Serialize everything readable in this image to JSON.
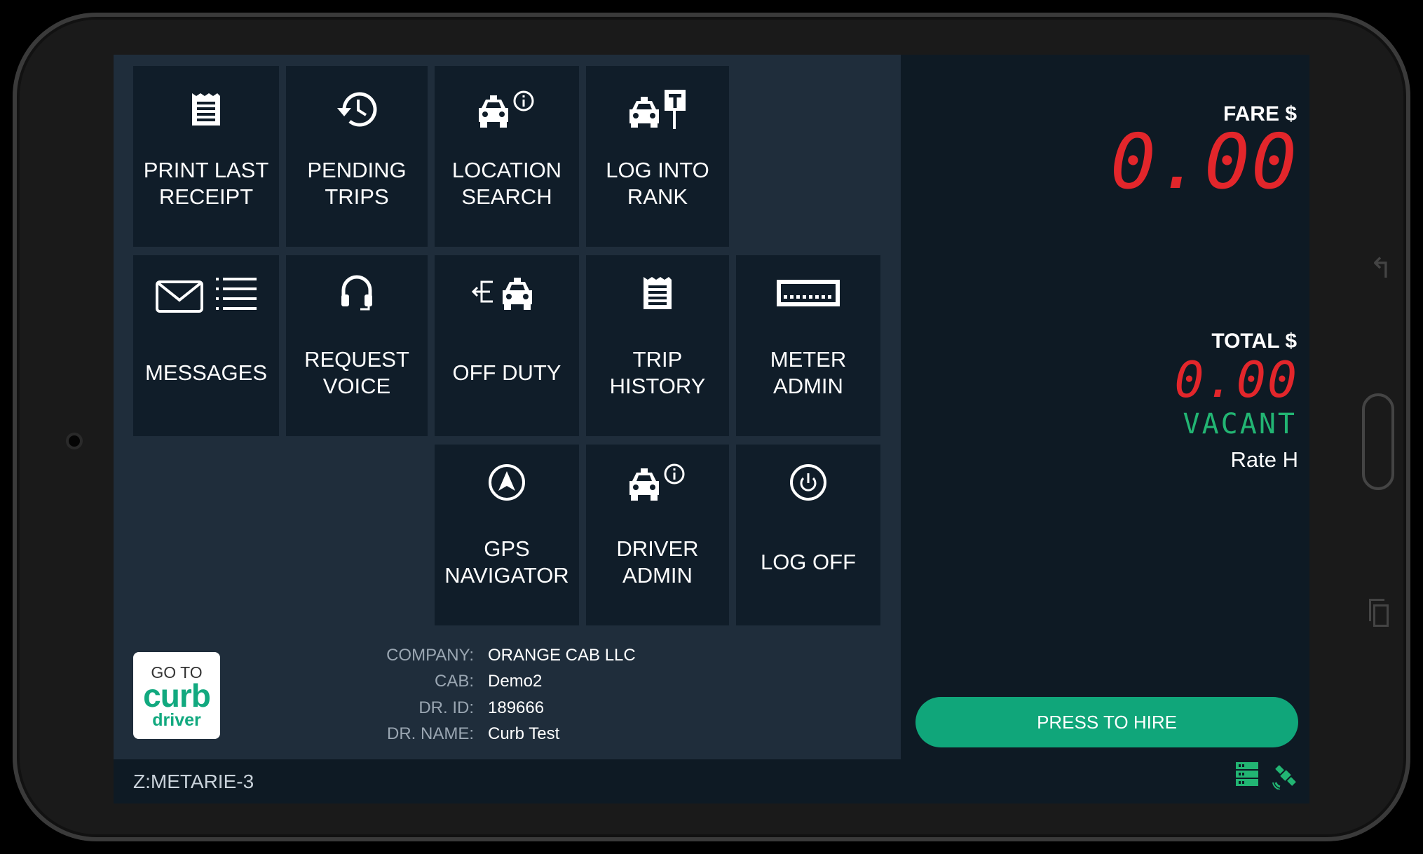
{
  "tiles": [
    {
      "id": "print-last-receipt",
      "label": "PRINT LAST\nRECEIPT",
      "icon": "receipt-icon"
    },
    {
      "id": "pending-trips",
      "label": "PENDING\nTRIPS",
      "icon": "history-clock-icon"
    },
    {
      "id": "location-search",
      "label": "LOCATION\nSEARCH",
      "icon": "taxi-info-icon"
    },
    {
      "id": "log-into-rank",
      "label": "LOG INTO\nRANK",
      "icon": "taxi-rank-sign-icon"
    },
    {
      "id": "messages",
      "label": "MESSAGES",
      "icon": "envelope-list-icon"
    },
    {
      "id": "request-voice",
      "label": "REQUEST\nVOICE",
      "icon": "headset-icon"
    },
    {
      "id": "off-duty",
      "label": "OFF DUTY",
      "icon": "exit-taxi-icon"
    },
    {
      "id": "trip-history",
      "label": "TRIP\nHISTORY",
      "icon": "receipt-icon"
    },
    {
      "id": "meter-admin",
      "label": "METER\nADMIN",
      "icon": "meter-display-icon"
    },
    {
      "id": "gps-navigator",
      "label": "GPS\nNAVIGATOR",
      "icon": "navigation-arrow-icon"
    },
    {
      "id": "driver-admin",
      "label": "DRIVER\nADMIN",
      "icon": "taxi-info-icon"
    },
    {
      "id": "log-off",
      "label": "LOG OFF",
      "icon": "power-icon"
    }
  ],
  "curb": {
    "goto": "GO TO",
    "brand": "curb",
    "driver": "driver"
  },
  "info": {
    "company_label": "COMPANY:",
    "company": "ORANGE CAB LLC",
    "cab_label": "CAB:",
    "cab": "Demo2",
    "drid_label": "DR. ID:",
    "drid": "189666",
    "drname_label": "DR. NAME:",
    "drname": "Curb Test"
  },
  "zone": "Z:METARIE-3",
  "meter": {
    "fare_label": "FARE $",
    "fare": "0.00",
    "total_label": "TOTAL $",
    "total": "0.00",
    "status": "VACANT",
    "rate": "Rate H"
  },
  "hire_button": "PRESS TO HIRE",
  "colors": {
    "accent": "#10a67a",
    "digits": "#e3262b",
    "vacant": "#22b573",
    "tile": "#101d29",
    "panel": "#1f2d3b"
  },
  "status_icons": [
    "server-status-icon",
    "satellite-gps-icon"
  ]
}
